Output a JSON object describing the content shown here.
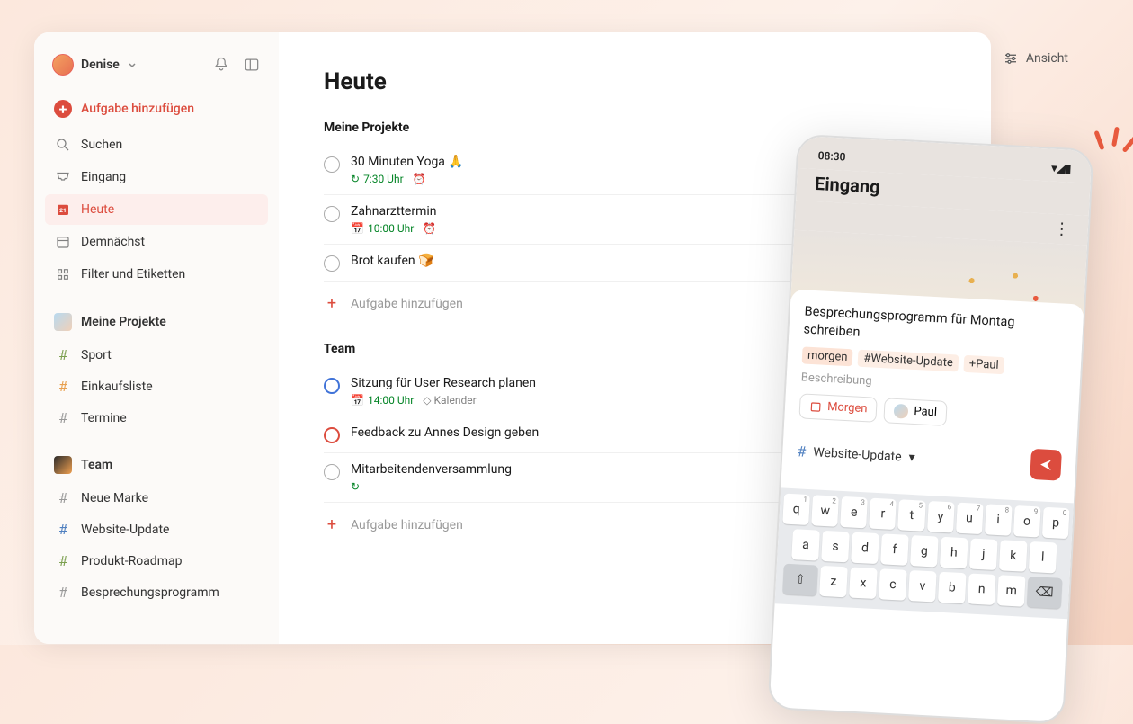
{
  "user": {
    "name": "Denise"
  },
  "nav": {
    "add": "Aufgabe hinzufügen",
    "search": "Suchen",
    "inbox": "Eingang",
    "today": "Heute",
    "upcoming": "Demnächst",
    "filters": "Filter und Etiketten"
  },
  "projects": {
    "header": "Meine Projekte",
    "items": [
      "Sport",
      "Einkaufsliste",
      "Termine"
    ]
  },
  "team": {
    "header": "Team",
    "items": [
      "Neue Marke",
      "Website-Update",
      "Produkt-Roadmap",
      "Besprechungsprogramm"
    ]
  },
  "view_label": "Ansicht",
  "page": {
    "title": "Heute",
    "group1": "Meine Projekte",
    "group2": "Team",
    "add_task": "Aufgabe hinzufügen"
  },
  "tasks_projects": [
    {
      "title": "30 Minuten Yoga 🙏",
      "time": "7:30 Uhr",
      "recurring": true,
      "alarm": true
    },
    {
      "title": "Zahnarzttermin",
      "time": "10:00 Uhr",
      "date_icon": true,
      "alarm": true
    },
    {
      "title": "Brot kaufen 🍞"
    }
  ],
  "tasks_team": [
    {
      "title": "Sitzung für User Research planen",
      "time": "14:00 Uhr",
      "date_icon": true,
      "calendar": "Kalender",
      "priority": "blue"
    },
    {
      "title": "Feedback zu Annes Design geben",
      "priority": "red"
    },
    {
      "title": "Mitarbeitendenversammlung",
      "recurring": true
    }
  ],
  "phone": {
    "time": "08:30",
    "header": "Eingang",
    "task_title": "Besprechungsprogramm für Montag schreiben",
    "chip_morgen": "morgen",
    "chip_project": "#Website-Update",
    "chip_paul": "+Paul",
    "desc": "Beschreibung",
    "pill_morgen": "Morgen",
    "pill_paul": "Paul",
    "project": "Website-Update",
    "keys_row1": [
      [
        "q",
        "1"
      ],
      [
        "w",
        "2"
      ],
      [
        "e",
        "3"
      ],
      [
        "r",
        "4"
      ],
      [
        "t",
        "5"
      ],
      [
        "y",
        "6"
      ],
      [
        "u",
        "7"
      ],
      [
        "i",
        "8"
      ],
      [
        "o",
        "9"
      ],
      [
        "p",
        "0"
      ]
    ],
    "keys_row2": [
      "a",
      "s",
      "d",
      "f",
      "g",
      "h",
      "j",
      "k",
      "l"
    ],
    "keys_row3": [
      "z",
      "x",
      "c",
      "v",
      "b",
      "n",
      "m"
    ]
  }
}
